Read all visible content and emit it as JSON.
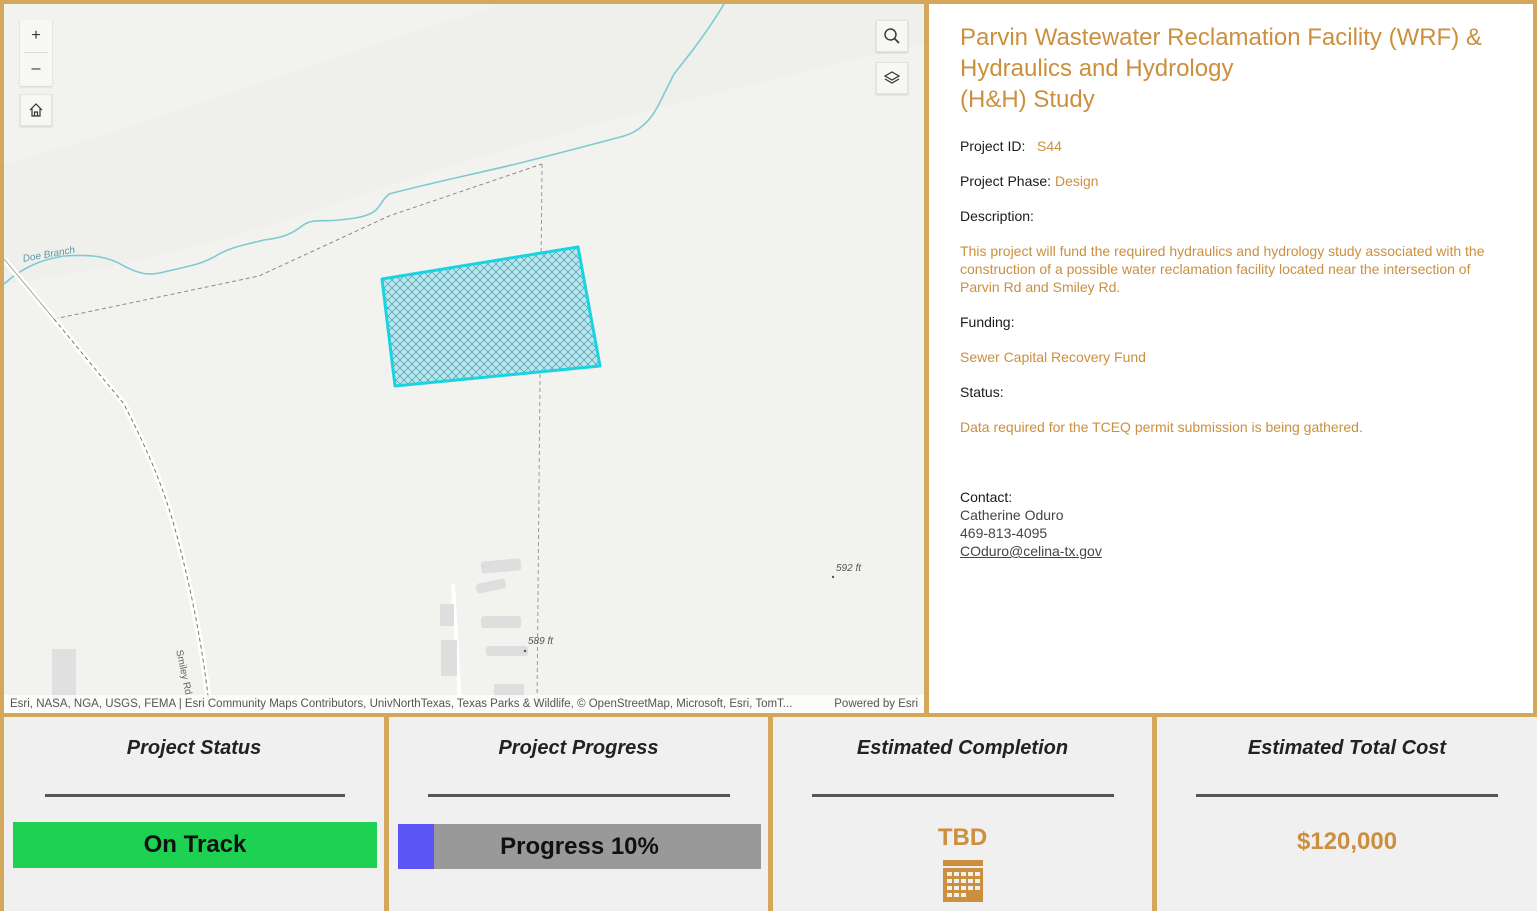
{
  "map": {
    "labels": {
      "stream": "Doe Branch",
      "road": "Smiley Rd",
      "elev1": "592 ft",
      "elev2": "589 ft"
    },
    "controls": {
      "zoom_in": "+",
      "zoom_out": "–"
    },
    "attribution": "Esri, NASA, NGA, USGS, FEMA | Esri Community Maps Contributors, UnivNorthTexas, Texas Parks & Wildlife, © OpenStreetMap, Microsoft, Esri, TomT...",
    "powered_by": "Powered by Esri",
    "colors": {
      "polygon": "#19d3e0",
      "stream": "#7ccbd3"
    }
  },
  "project": {
    "title_lines": [
      "Parvin Wastewater Reclamation Facility (WRF) &",
      "Hydraulics and Hydrology",
      "(H&H) Study"
    ],
    "id_label": "Project ID:",
    "id_value": "S44",
    "phase_label": "Project Phase:",
    "phase_value": "Design",
    "description_label": "Description:",
    "description": "This project will fund the required hydraulics and hydrology study associated with the construction of a possible water reclamation facility located near the intersection of Parvin Rd and Smiley Rd.",
    "funding_label": "Funding:",
    "funding": "Sewer Capital Recovery Fund",
    "status_label": "Status:",
    "status": "Data required for the TCEQ permit submission is being gathered.",
    "contact_label": "Contact:",
    "contact_name": "Catherine Oduro",
    "contact_phone": "469-813-4095",
    "contact_email": "COduro@celina-tx.gov"
  },
  "cards": {
    "status": {
      "title": "Project Status",
      "value": "On Track",
      "color": "#1fd152"
    },
    "progress": {
      "title": "Project Progress",
      "label": "Progress 10%",
      "percent": 10,
      "fill_color": "#5b55f5"
    },
    "completion": {
      "title": "Estimated Completion",
      "value": "TBD",
      "icon": "calendar-icon"
    },
    "cost": {
      "title": "Estimated Total Cost",
      "value": "$120,000"
    }
  },
  "colors": {
    "accent": "#cb8f3e",
    "border": "#d4a75a"
  }
}
